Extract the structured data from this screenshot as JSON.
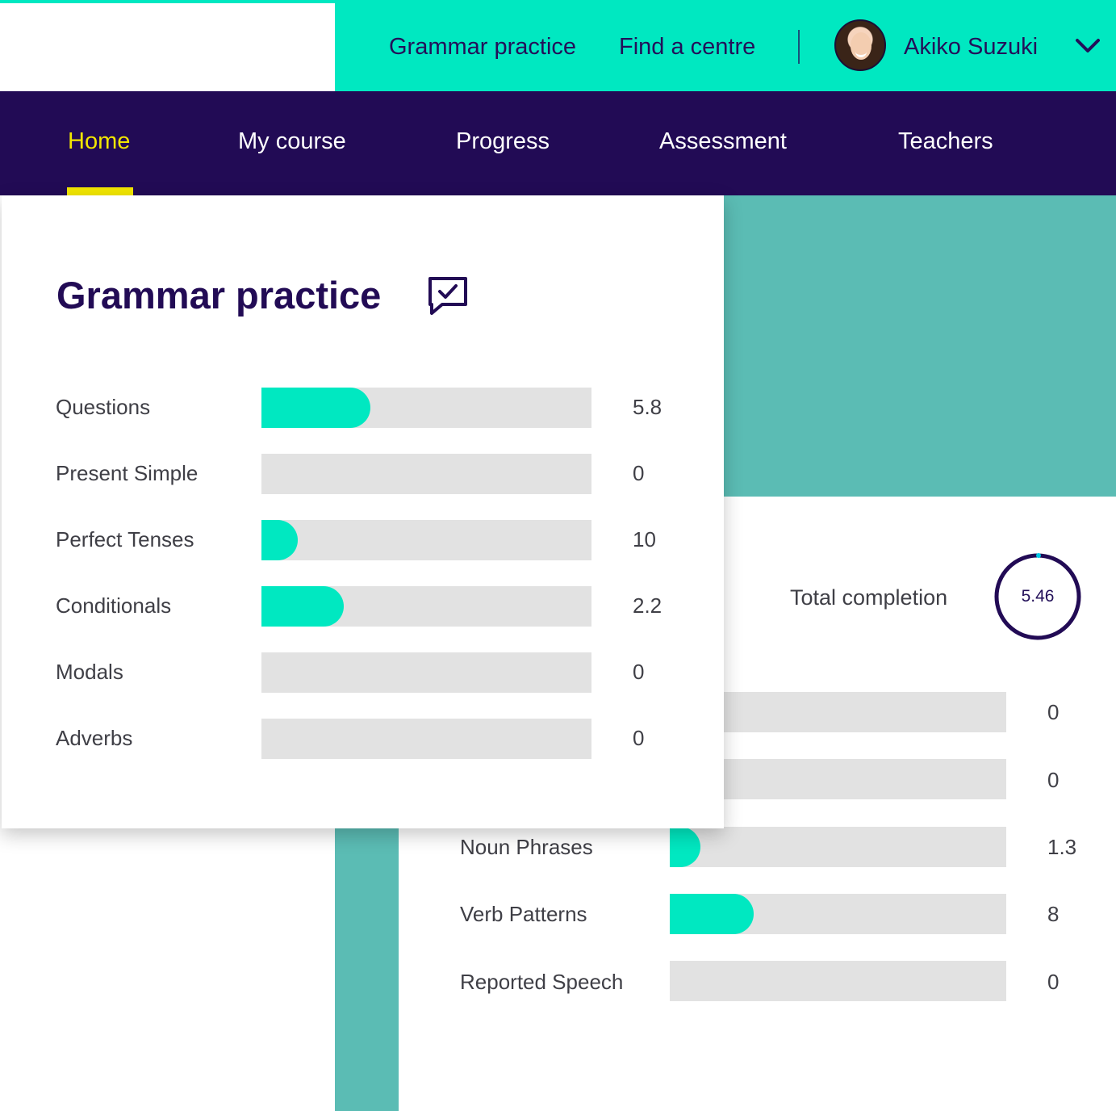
{
  "header": {
    "links": [
      {
        "label": "Grammar practice"
      },
      {
        "label": "Find a centre"
      }
    ],
    "user": {
      "name": "Akiko Suzuki"
    },
    "icons": {
      "avatar": "user-avatar",
      "menu": "chevron-down-icon"
    }
  },
  "nav": {
    "items": [
      {
        "label": "Home",
        "active": true
      },
      {
        "label": "My course"
      },
      {
        "label": "Progress"
      },
      {
        "label": "Assessment"
      },
      {
        "label": "Teachers"
      }
    ]
  },
  "grammar_card": {
    "title": "Grammar practice",
    "title_icon": "chat-check-icon",
    "rows": [
      {
        "label": "Questions",
        "value": "5.8",
        "fill_fraction": 0.33
      },
      {
        "label": "Present Simple",
        "value": "0",
        "fill_fraction": 0
      },
      {
        "label": "Perfect Tenses",
        "value": "10",
        "fill_fraction": 0.11
      },
      {
        "label": "Conditionals",
        "value": "2.2",
        "fill_fraction": 0.25
      },
      {
        "label": "Modals",
        "value": "0",
        "fill_fraction": 0
      },
      {
        "label": "Adverbs",
        "value": "0",
        "fill_fraction": 0
      }
    ]
  },
  "back_card": {
    "completion_label": "Total completion",
    "completion_value": "5.46",
    "rows": [
      {
        "label": "",
        "value": "0",
        "fill_fraction": 0
      },
      {
        "label": "",
        "value": "0",
        "fill_fraction": 0
      },
      {
        "label": "Noun Phrases",
        "value": "1.3",
        "fill_fraction": 0.09
      },
      {
        "label": "Verb Patterns",
        "value": "8",
        "fill_fraction": 0.25
      },
      {
        "label": "Reported Speech",
        "value": "0",
        "fill_fraction": 0
      }
    ]
  },
  "colors": {
    "accent_mint": "#00e8c1",
    "navy": "#220b55",
    "active_yellow": "#f2e600",
    "teal_background": "#5bbcb4",
    "track_grey": "#e2e2e2"
  }
}
